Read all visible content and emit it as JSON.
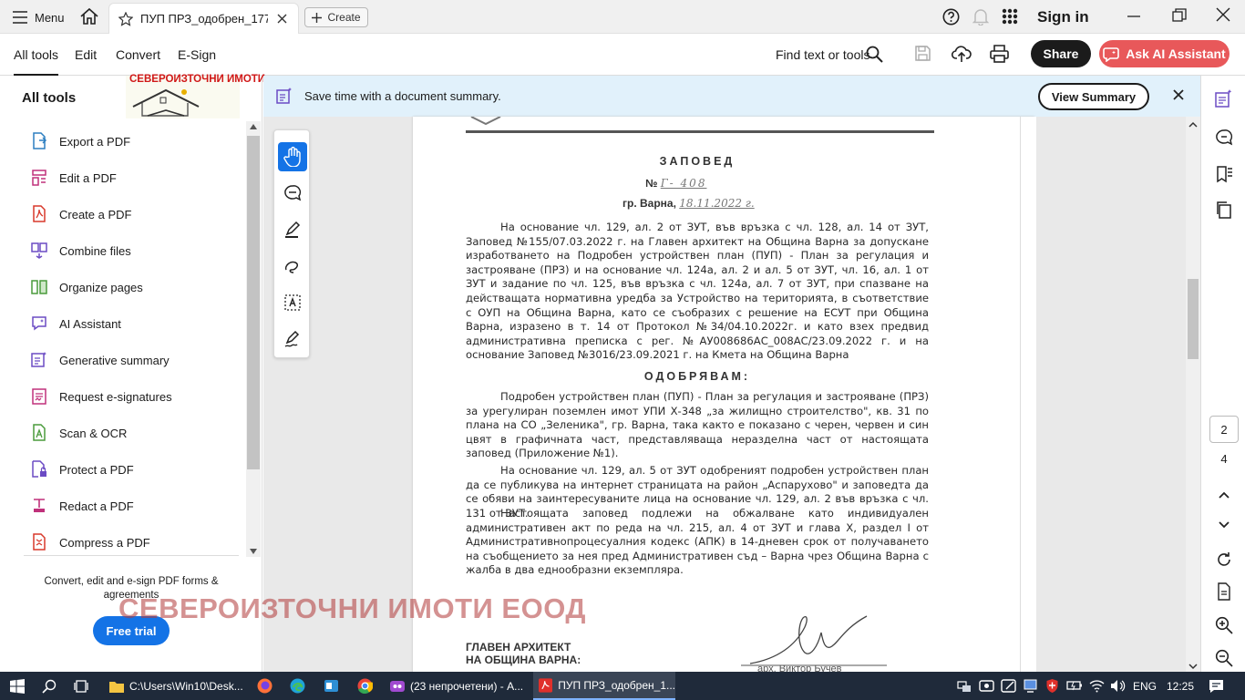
{
  "titlebar": {
    "menu_label": "Menu",
    "doc_tab_label": "ПУП ПРЗ_одобрен_177...",
    "create_label": "Create",
    "signin_label": "Sign in"
  },
  "toolbar": {
    "tabs": [
      "All tools",
      "Edit",
      "Convert",
      "E-Sign"
    ],
    "find_label": "Find text or tools",
    "share_label": "Share",
    "ai_label": "Ask AI Assistant"
  },
  "sidebar": {
    "title": "All tools",
    "logo_text": "СЕВЕРОИЗТОЧНИ ИМОТИ",
    "tools": [
      {
        "label": "Export a PDF",
        "icon": "export-pdf-icon"
      },
      {
        "label": "Edit a PDF",
        "icon": "edit-pdf-icon"
      },
      {
        "label": "Create a PDF",
        "icon": "create-pdf-icon"
      },
      {
        "label": "Combine files",
        "icon": "combine-files-icon"
      },
      {
        "label": "Organize pages",
        "icon": "organize-pages-icon"
      },
      {
        "label": "AI Assistant",
        "icon": "ai-assistant-icon"
      },
      {
        "label": "Generative summary",
        "icon": "generative-summary-icon"
      },
      {
        "label": "Request e-signatures",
        "icon": "request-esignatures-icon"
      },
      {
        "label": "Scan & OCR",
        "icon": "scan-ocr-icon"
      },
      {
        "label": "Protect a PDF",
        "icon": "protect-pdf-icon"
      },
      {
        "label": "Redact a PDF",
        "icon": "redact-pdf-icon"
      },
      {
        "label": "Compress a PDF",
        "icon": "compress-pdf-icon"
      }
    ],
    "promo_text": "Convert, edit and e-sign PDF forms & agreements",
    "trial_label": "Free trial"
  },
  "banner": {
    "text": "Save time with a document summary.",
    "button_label": "View Summary"
  },
  "document": {
    "title": "ЗАПОВЕД",
    "number_prefix": "№",
    "number_value": "Г- 408",
    "place": "гр. Варна,",
    "date": "18.11.2022 г.",
    "paragraph_1": "На основание чл. 129, ал. 2 от ЗУТ, във връзка с чл. 128, ал. 14 от ЗУТ, Заповед №155/07.03.2022 г. на Главен архитект на Община Варна за допускане изработването на Подробен устройствен план (ПУП) - План за регулация и застрояване (ПРЗ) и на основание чл. 124а, ал. 2 и ал. 5 от ЗУТ, чл. 16, ал. 1 от ЗУТ и задание по чл. 125, във връзка с чл. 124а, ал. 7 от ЗУТ, при спазване на действащата нормативна уредба за Устройство на територията, в съответствие с ОУП на Община Варна, като се съобразих с решение на ЕСУТ при Община Варна, изразено в т. 14 от Протокол №34/04.10.2022г. и като взех предвид административна преписка с рег. №АУ008686АС_008АС/23.09.2022 г. и на основание Заповед №3016/23.09.2021 г. на Кмета на Община Варна",
    "approve_heading": "ОДОБРЯВАМ:",
    "paragraph_2": "Подробен устройствен план (ПУП) - План за регулация и застрояване (ПРЗ) за урегулиран поземлен имот УПИ Х-348 „за жилищно строителство\", кв. 31 по плана на СО „Зеленика\", гр. Варна, така както е показано с черен, червен и син цвят в графичната част, представляваща неразделна част от настоящата заповед (Приложение №1).",
    "paragraph_3": "На основание чл. 129, ал. 5 от ЗУТ одобреният подробен устройствен план да се публикува на интернет страницата на район „Аспарухово\" и заповедта да се обяви на заинтересуваните лица на основание чл. 129, ал. 2 във връзка с чл. 131 от ЗУТ.",
    "paragraph_4": "Настоящата заповед подлежи на обжалване като индивидуален административен акт по реда на чл. 215, ал. 4 от ЗУТ и глава Х, раздел I от Административнопроцесуалния кодекс (АПК) в 14-дневен срок от получаването на съобщението за нея пред Административен съд – Варна чрез Община Варна с жалба в два еднообразни екземпляра.",
    "signatory_line1": "ГЛАВЕН АРХИТЕКТ",
    "signatory_line2": "НА ОБЩИНА ВАРНА:",
    "signatory_name": "арх. Виктор Бучев",
    "watermark": "СЕВЕРОИЗТОЧНИ ИМОТИ ЕООД"
  },
  "navigation": {
    "current_page": "2",
    "total_pages": "4"
  },
  "taskbar": {
    "items": [
      {
        "label": "C:\\Users\\Win10\\Desk...",
        "icon": "folder-icon"
      },
      {
        "label": "(23 непрочетени) - А...",
        "icon": "mail-icon"
      },
      {
        "label": "ПУП ПРЗ_одобрен_1...",
        "icon": "acrobat-icon"
      }
    ],
    "lang": "ENG",
    "time": "12:25"
  },
  "colors": {
    "accent": "#1473e6",
    "ai_button": "#e8585a",
    "banner_bg": "#e1f1fb",
    "taskbar_bg": "#1f2a3a",
    "watermark": "#b23a3a"
  }
}
